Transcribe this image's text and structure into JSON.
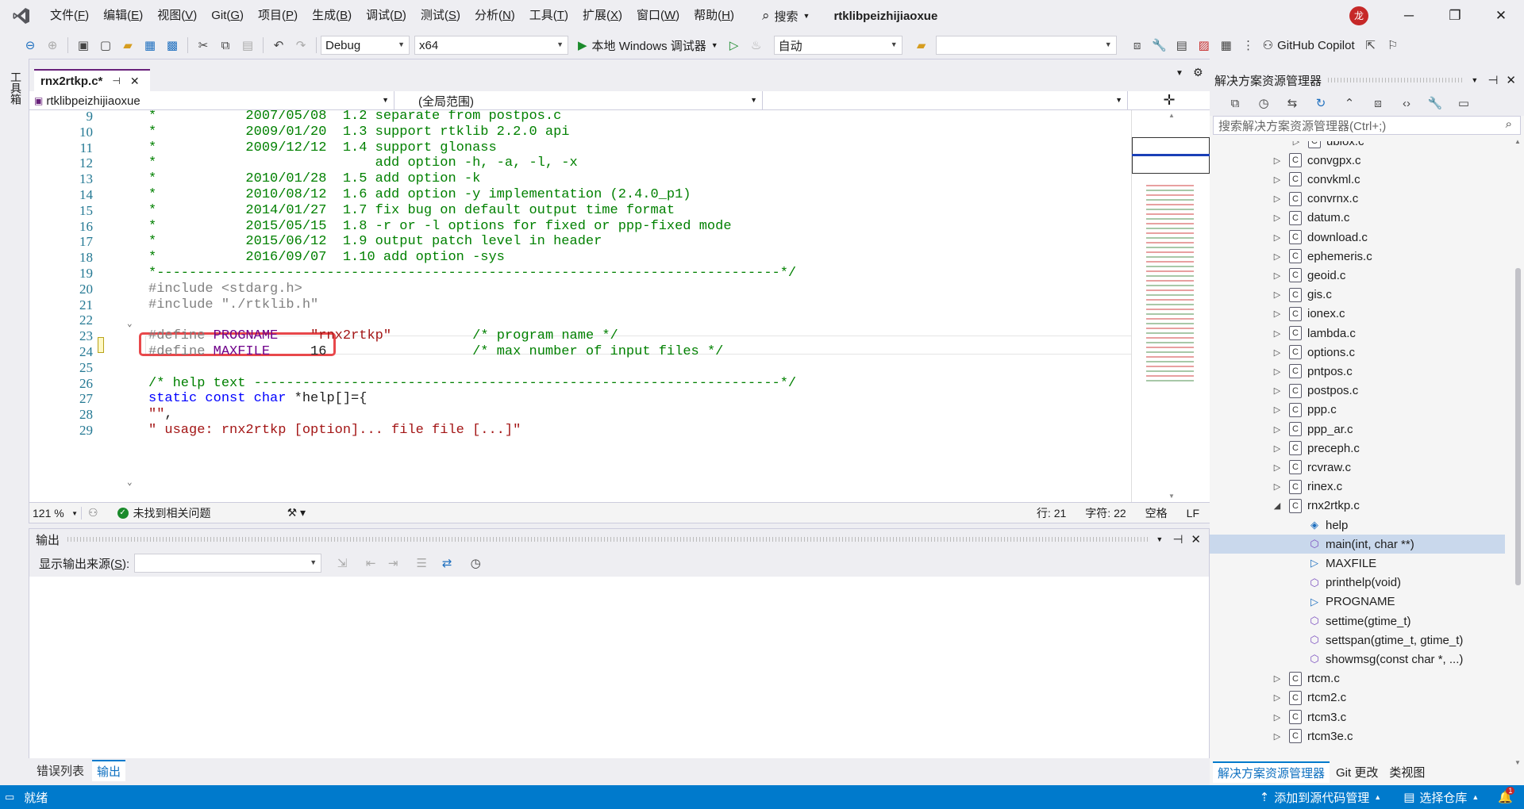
{
  "menu": {
    "items": [
      {
        "label": "文件(",
        "key": "F",
        "end": ")"
      },
      {
        "label": "编辑(",
        "key": "E",
        "end": ")"
      },
      {
        "label": "视图(",
        "key": "V",
        "end": ")"
      },
      {
        "label": "Git(",
        "key": "G",
        "end": ")"
      },
      {
        "label": "项目(",
        "key": "P",
        "end": ")"
      },
      {
        "label": "生成(",
        "key": "B",
        "end": ")"
      },
      {
        "label": "调试(",
        "key": "D",
        "end": ")"
      },
      {
        "label": "测试(",
        "key": "S",
        "end": ")"
      },
      {
        "label": "分析(",
        "key": "N",
        "end": ")"
      },
      {
        "label": "工具(",
        "key": "T",
        "end": ")"
      },
      {
        "label": "扩展(",
        "key": "X",
        "end": ")"
      },
      {
        "label": "窗口(",
        "key": "W",
        "end": ")"
      },
      {
        "label": "帮助(",
        "key": "H",
        "end": ")"
      }
    ],
    "search_label": "搜索",
    "solution_name": "rtklibpeizhijiaoxue",
    "avatar_text": "龙"
  },
  "toolbar": {
    "config": "Debug",
    "platform": "x64",
    "run_label": "本地 Windows 调试器",
    "auto_label": "自动",
    "copilot_label": "GitHub Copilot"
  },
  "left_strip": {
    "toolbox_label": "工具箱"
  },
  "editor": {
    "tab_label": "rnx2rtkp.c*",
    "nav_project": "rtklibpeizhijiaoxue",
    "nav_scope": "(全局范围)",
    "lines": [
      {
        "num": "9",
        "tokens": [
          {
            "c": "c-com",
            "t": "*           2007/05/08  1.2 separate from postpos.c"
          }
        ]
      },
      {
        "num": "10",
        "tokens": [
          {
            "c": "c-com",
            "t": "*           2009/01/20  1.3 support rtklib 2.2.0 api"
          }
        ]
      },
      {
        "num": "11",
        "tokens": [
          {
            "c": "c-com",
            "t": "*           2009/12/12  1.4 support glonass"
          }
        ]
      },
      {
        "num": "12",
        "tokens": [
          {
            "c": "c-com",
            "t": "*                           add option -h, -a, -l, -x"
          }
        ]
      },
      {
        "num": "13",
        "tokens": [
          {
            "c": "c-com",
            "t": "*           2010/01/28  1.5 add option -k"
          }
        ]
      },
      {
        "num": "14",
        "tokens": [
          {
            "c": "c-com",
            "t": "*           2010/08/12  1.6 add option -y implementation (2.4.0_p1)"
          }
        ]
      },
      {
        "num": "15",
        "tokens": [
          {
            "c": "c-com",
            "t": "*           2014/01/27  1.7 fix bug on default output time format"
          }
        ]
      },
      {
        "num": "16",
        "tokens": [
          {
            "c": "c-com",
            "t": "*           2015/05/15  1.8 -r or -l options for fixed or ppp-fixed mode"
          }
        ]
      },
      {
        "num": "17",
        "tokens": [
          {
            "c": "c-com",
            "t": "*           2015/06/12  1.9 output patch level in header"
          }
        ]
      },
      {
        "num": "18",
        "tokens": [
          {
            "c": "c-com",
            "t": "*           2016/09/07  1.10 add option -sys"
          }
        ]
      },
      {
        "num": "19",
        "tokens": [
          {
            "c": "c-com",
            "t": "*-----------------------------------------------------------------------------*/"
          }
        ]
      },
      {
        "num": "20",
        "tokens": [
          {
            "c": "c-pre",
            "t": "#include <stdarg.h>"
          }
        ]
      },
      {
        "num": "21",
        "tokens": [
          {
            "c": "c-pre",
            "t": "#include \"./rtklib.h\""
          }
        ]
      },
      {
        "num": "22",
        "tokens": []
      },
      {
        "num": "23",
        "tokens": [
          {
            "c": "c-pre",
            "t": "#define "
          },
          {
            "c": "c-mac",
            "t": "PROGNAME"
          },
          {
            "c": "",
            "t": "    "
          },
          {
            "c": "c-str",
            "t": "\"rnx2rtkp\""
          },
          {
            "c": "",
            "t": "          "
          },
          {
            "c": "c-com",
            "t": "/* program name */"
          }
        ]
      },
      {
        "num": "24",
        "tokens": [
          {
            "c": "c-pre",
            "t": "#define "
          },
          {
            "c": "c-mac",
            "t": "MAXFILE"
          },
          {
            "c": "",
            "t": "     16                  "
          },
          {
            "c": "c-com",
            "t": "/* max number of input files */"
          }
        ]
      },
      {
        "num": "25",
        "tokens": []
      },
      {
        "num": "26",
        "tokens": [
          {
            "c": "c-com",
            "t": "/* help text -----------------------------------------------------------------*/"
          }
        ]
      },
      {
        "num": "27",
        "tokens": [
          {
            "c": "c-kw",
            "t": "static const char"
          },
          {
            "c": "",
            "t": " *help[]={"
          }
        ]
      },
      {
        "num": "28",
        "tokens": [
          {
            "c": "c-str",
            "t": "\"\""
          },
          {
            "c": "",
            "t": ","
          }
        ]
      },
      {
        "num": "29",
        "tokens": [
          {
            "c": "c-str",
            "t": "\" usage: rnx2rtkp [option]... file file [...]\""
          }
        ]
      }
    ],
    "status": {
      "zoom": "121 %",
      "issues": "未找到相关问题",
      "row": "行: 21",
      "col": "字符: 22",
      "spacing": "空格",
      "eol": "LF"
    }
  },
  "output": {
    "title": "输出",
    "source_label": "显示输出来源(",
    "source_key": "S",
    "source_end": "):"
  },
  "bottom_tabs": {
    "errors": "错误列表",
    "output": "输出"
  },
  "solution": {
    "title": "解决方案资源管理器",
    "search_placeholder": "搜索解决方案资源管理器(Ctrl+;)",
    "items": [
      {
        "label": "ublox.c",
        "kind": "file",
        "indent": 1,
        "expanded": false
      },
      {
        "label": "convgpx.c",
        "kind": "file",
        "indent": 0,
        "expanded": false
      },
      {
        "label": "convkml.c",
        "kind": "file",
        "indent": 0,
        "expanded": false
      },
      {
        "label": "convrnx.c",
        "kind": "file",
        "indent": 0,
        "expanded": false
      },
      {
        "label": "datum.c",
        "kind": "file",
        "indent": 0,
        "expanded": false
      },
      {
        "label": "download.c",
        "kind": "file",
        "indent": 0,
        "expanded": false
      },
      {
        "label": "ephemeris.c",
        "kind": "file",
        "indent": 0,
        "expanded": false
      },
      {
        "label": "geoid.c",
        "kind": "file",
        "indent": 0,
        "expanded": false
      },
      {
        "label": "gis.c",
        "kind": "file",
        "indent": 0,
        "expanded": false
      },
      {
        "label": "ionex.c",
        "kind": "file",
        "indent": 0,
        "expanded": false
      },
      {
        "label": "lambda.c",
        "kind": "file",
        "indent": 0,
        "expanded": false
      },
      {
        "label": "options.c",
        "kind": "file",
        "indent": 0,
        "expanded": false
      },
      {
        "label": "pntpos.c",
        "kind": "file",
        "indent": 0,
        "expanded": false
      },
      {
        "label": "postpos.c",
        "kind": "file",
        "indent": 0,
        "expanded": false
      },
      {
        "label": "ppp.c",
        "kind": "file",
        "indent": 0,
        "expanded": false
      },
      {
        "label": "ppp_ar.c",
        "kind": "file",
        "indent": 0,
        "expanded": false
      },
      {
        "label": "preceph.c",
        "kind": "file",
        "indent": 0,
        "expanded": false
      },
      {
        "label": "rcvraw.c",
        "kind": "file",
        "indent": 0,
        "expanded": false
      },
      {
        "label": "rinex.c",
        "kind": "file",
        "indent": 0,
        "expanded": false
      },
      {
        "label": "rnx2rtkp.c",
        "kind": "file",
        "indent": 0,
        "expanded": true
      },
      {
        "label": "help",
        "kind": "var",
        "indent": 1
      },
      {
        "label": "main(int, char **)",
        "kind": "func",
        "indent": 1,
        "selected": true
      },
      {
        "label": "MAXFILE",
        "kind": "macro",
        "indent": 1
      },
      {
        "label": "printhelp(void)",
        "kind": "func",
        "indent": 1
      },
      {
        "label": "PROGNAME",
        "kind": "macro",
        "indent": 1
      },
      {
        "label": "settime(gtime_t)",
        "kind": "func",
        "indent": 1
      },
      {
        "label": "settspan(gtime_t, gtime_t)",
        "kind": "func",
        "indent": 1
      },
      {
        "label": "showmsg(const char *, ...)",
        "kind": "func",
        "indent": 1
      },
      {
        "label": "rtcm.c",
        "kind": "file",
        "indent": 0,
        "expanded": false
      },
      {
        "label": "rtcm2.c",
        "kind": "file",
        "indent": 0,
        "expanded": false
      },
      {
        "label": "rtcm3.c",
        "kind": "file",
        "indent": 0,
        "expanded": false
      },
      {
        "label": "rtcm3e.c",
        "kind": "file",
        "indent": 0,
        "expanded": false
      }
    ],
    "tabs": [
      "解决方案资源管理器",
      "Git 更改",
      "类视图"
    ]
  },
  "statusbar": {
    "ready": "就绪",
    "add_source": "添加到源代码管理",
    "select_repo": "选择仓库",
    "notifications": "1"
  },
  "colors": {
    "accent": "#68217a",
    "status": "#007acc",
    "highlight": "#e8484b"
  }
}
